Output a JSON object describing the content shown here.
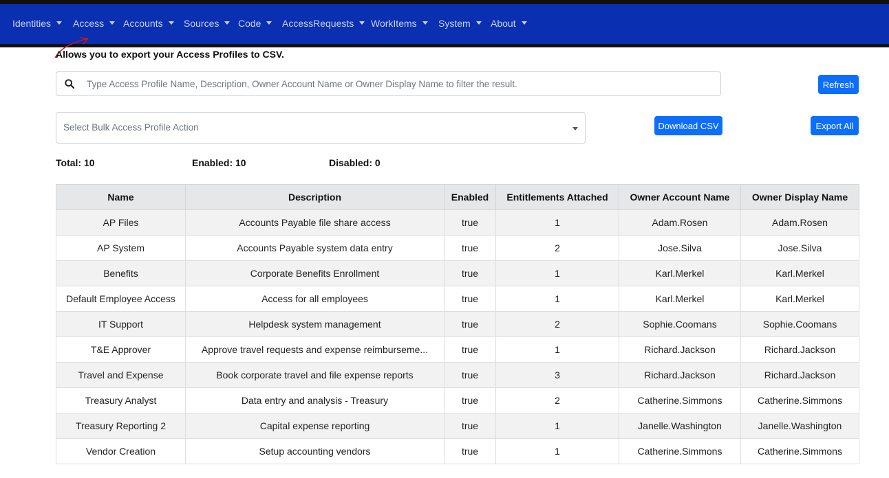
{
  "nav": {
    "items": [
      {
        "label": "Identities"
      },
      {
        "label": "Access"
      },
      {
        "label": "Accounts"
      },
      {
        "label": "Sources"
      },
      {
        "label": "Code"
      },
      {
        "label": "AccessRequests"
      },
      {
        "label": "WorkItems"
      },
      {
        "label": "System"
      },
      {
        "label": "About"
      }
    ]
  },
  "page": {
    "description": "Allows you to export your Access Profiles to CSV."
  },
  "search": {
    "placeholder": "Type Access Profile Name, Description, Owner Account Name or Owner Display Name to filter the result.",
    "value": ""
  },
  "buttons": {
    "refresh": "Refresh",
    "download_csv": "Download CSV",
    "export_all": "Export All"
  },
  "bulk_action": {
    "placeholder": "Select Bulk Access Profile Action"
  },
  "stats": {
    "total": "Total: 10",
    "enabled": "Enabled: 10",
    "disabled": "Disabled: 0"
  },
  "table": {
    "headers": [
      "Name",
      "Description",
      "Enabled",
      "Entitlements Attached",
      "Owner Account Name",
      "Owner Display Name"
    ],
    "rows": [
      [
        "AP Files",
        "Accounts Payable file share access",
        "true",
        "1",
        "Adam.Rosen",
        "Adam.Rosen"
      ],
      [
        "AP System",
        "Accounts Payable system data entry",
        "true",
        "2",
        "Jose.Silva",
        "Jose.Silva"
      ],
      [
        "Benefits",
        "Corporate Benefits Enrollment",
        "true",
        "1",
        "Karl.Merkel",
        "Karl.Merkel"
      ],
      [
        "Default Employee Access",
        "Access for all employees",
        "true",
        "1",
        "Karl.Merkel",
        "Karl.Merkel"
      ],
      [
        "IT Support",
        "Helpdesk system management",
        "true",
        "2",
        "Sophie.Coomans",
        "Sophie.Coomans"
      ],
      [
        "T&E Approver",
        "Approve travel requests and expense reimburseme...",
        "true",
        "1",
        "Richard.Jackson",
        "Richard.Jackson"
      ],
      [
        "Travel and Expense",
        "Book corporate travel and file expense reports",
        "true",
        "3",
        "Richard.Jackson",
        "Richard.Jackson"
      ],
      [
        "Treasury Analyst",
        "Data entry and analysis - Treasury",
        "true",
        "2",
        "Catherine.Simmons",
        "Catherine.Simmons"
      ],
      [
        "Treasury Reporting 2",
        "Capital expense reporting",
        "true",
        "1",
        "Janelle.Washington",
        "Janelle.Washington"
      ],
      [
        "Vendor Creation",
        "Setup accounting vendors",
        "true",
        "1",
        "Catherine.Simmons",
        "Catherine.Simmons"
      ]
    ]
  }
}
